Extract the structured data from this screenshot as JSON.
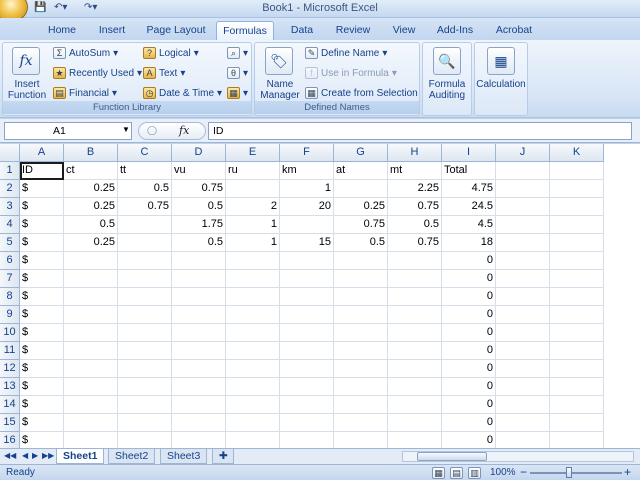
{
  "window": {
    "title": "Book1 - Microsoft Excel"
  },
  "tabs": [
    "Home",
    "Insert",
    "Page Layout",
    "Formulas",
    "Data",
    "Review",
    "View",
    "Add-Ins",
    "Acrobat"
  ],
  "active_tab": "Formulas",
  "ribbon": {
    "insert_function": {
      "line1": "Insert",
      "line2": "Function"
    },
    "autosum": "AutoSum",
    "recently_used": "Recently Used",
    "financial": "Financial",
    "logical": "Logical",
    "text": "Text",
    "date_time": "Date & Time",
    "function_library": "Function Library",
    "name_manager": {
      "line1": "Name",
      "line2": "Manager"
    },
    "define_name": "Define Name",
    "use_in_formula": "Use in Formula",
    "create_from_selection": "Create from Selection",
    "defined_names": "Defined Names",
    "formula_auditing": {
      "line1": "Formula",
      "line2": "Auditing"
    },
    "calculation": "Calculation"
  },
  "formula_bar": {
    "name_box": "A1",
    "content": "ID"
  },
  "columns": [
    "A",
    "B",
    "C",
    "D",
    "E",
    "F",
    "G",
    "H",
    "I",
    "J",
    "K"
  ],
  "rows": [
    [
      "ID",
      "ct",
      "tt",
      "vu",
      "ru",
      "km",
      "at",
      "mt",
      "Total",
      "",
      ""
    ],
    [
      "$",
      "0.25",
      "0.5",
      "0.75",
      "",
      "1",
      "",
      "2.25",
      "4.75",
      "",
      ""
    ],
    [
      "$",
      "0.25",
      "0.75",
      "0.5",
      "2",
      "20",
      "0.25",
      "0.75",
      "24.5",
      "",
      ""
    ],
    [
      "$",
      "0.5",
      "",
      "1.75",
      "1",
      "",
      "0.75",
      "0.5",
      "4.5",
      "",
      ""
    ],
    [
      "$",
      "0.25",
      "",
      "0.5",
      "1",
      "15",
      "0.5",
      "0.75",
      "18",
      "",
      ""
    ],
    [
      "$",
      "",
      "",
      "",
      "",
      "",
      "",
      "",
      "0",
      "",
      ""
    ],
    [
      "$",
      "",
      "",
      "",
      "",
      "",
      "",
      "",
      "0",
      "",
      ""
    ],
    [
      "$",
      "",
      "",
      "",
      "",
      "",
      "",
      "",
      "0",
      "",
      ""
    ],
    [
      "$",
      "",
      "",
      "",
      "",
      "",
      "",
      "",
      "0",
      "",
      ""
    ],
    [
      "$",
      "",
      "",
      "",
      "",
      "",
      "",
      "",
      "0",
      "",
      ""
    ],
    [
      "$",
      "",
      "",
      "",
      "",
      "",
      "",
      "",
      "0",
      "",
      ""
    ],
    [
      "$",
      "",
      "",
      "",
      "",
      "",
      "",
      "",
      "0",
      "",
      ""
    ],
    [
      "$",
      "",
      "",
      "",
      "",
      "",
      "",
      "",
      "0",
      "",
      ""
    ],
    [
      "$",
      "",
      "",
      "",
      "",
      "",
      "",
      "",
      "0",
      "",
      ""
    ],
    [
      "$",
      "",
      "",
      "",
      "",
      "",
      "",
      "",
      "0",
      "",
      ""
    ],
    [
      "$",
      "",
      "",
      "",
      "",
      "",
      "",
      "",
      "0",
      "",
      ""
    ]
  ],
  "row_numbers": [
    "1",
    "2",
    "3",
    "4",
    "5",
    "6",
    "7",
    "8",
    "9",
    "10",
    "11",
    "12",
    "13",
    "14",
    "15",
    "16"
  ],
  "sheets": [
    "Sheet1",
    "Sheet2",
    "Sheet3"
  ],
  "active_sheet": "Sheet1",
  "status": {
    "text": "Ready",
    "zoom": "100%",
    "zoom_minus": "−",
    "zoom_plus": "+"
  }
}
